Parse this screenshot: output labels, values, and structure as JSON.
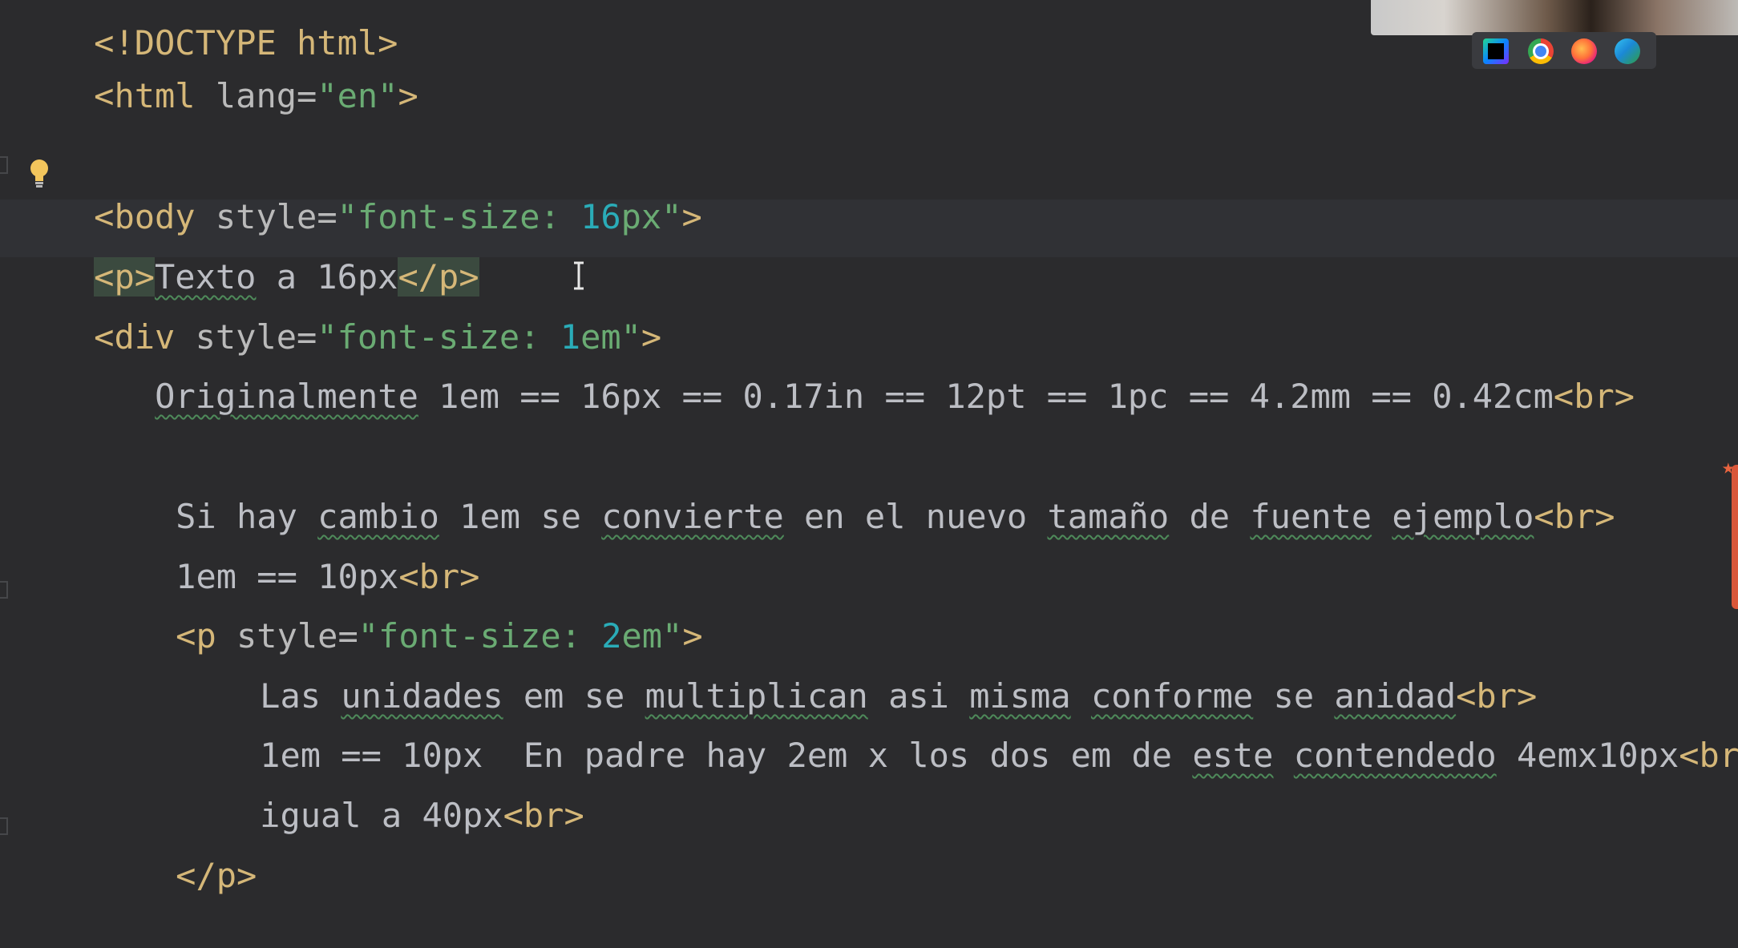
{
  "editor": {
    "lines": {
      "l0": {
        "partial": "<!DOCTYPE html>"
      },
      "l1": {
        "open": "<html",
        "attr": " lang=",
        "val": "\"en\"",
        "close": ">"
      },
      "l3": {
        "open": "<",
        "tag_rest": "body",
        "attr": " style=",
        "q1": "\"font-size: ",
        "num": "16",
        "q2": "px\"",
        "close": ">"
      },
      "l4": {
        "open": "<p>",
        "text1": "Texto",
        "text2": " a 16px",
        "close": "</p>"
      },
      "l5": {
        "open": "<div",
        "attr": " style=",
        "q1": "\"font-size: ",
        "num": "1",
        "q2": "em\"",
        "close": ">"
      },
      "l6": {
        "w1": "Originalmente",
        "rest": " 1em == 16px == 0.17in == 12pt == 1pc == 4.2mm == 0.42cm",
        "br": "<br>"
      },
      "l8": {
        "t1": "Si hay ",
        "w1": "cambio",
        "t2": " 1em se ",
        "w2": "convierte",
        "t3": " en el nuevo ",
        "w3": "tamaño",
        "t4": " de ",
        "w4": "fuente",
        "t5": " ",
        "w5": "ejemplo",
        "br": "<br>"
      },
      "l9": {
        "text": "1em == 10px",
        "br": "<br>"
      },
      "l10": {
        "open": "<p",
        "attr": " style=",
        "q1": "\"font-size: ",
        "num": "2",
        "q2": "em\"",
        "close": ">"
      },
      "l11": {
        "t1": "Las ",
        "w1": "unidades",
        "t2": " em se ",
        "w2": "multiplican",
        "t3": " asi ",
        "w3": "misma",
        "t4": " ",
        "w4": "conforme",
        "t5": " se ",
        "w5": "anidad",
        "br": "<br>"
      },
      "l12": {
        "t1": "1em == 10px  En padre hay 2em x los dos em de ",
        "w1": "este",
        "t2": " ",
        "w2": "contendedo",
        "t3": " 4emx10px",
        "br": "<br>"
      },
      "l13": {
        "text": "igual a 40px",
        "br": "<br>"
      },
      "l14": {
        "close": "</p>"
      }
    }
  },
  "icons": {
    "bulb": "lightbulb-icon",
    "cursor": "text-cursor-icon",
    "browsers": [
      "webstorm-icon",
      "chrome-icon",
      "firefox-icon",
      "edge-icon"
    ]
  },
  "colors": {
    "background": "#2b2b2d",
    "tag": "#d5b778",
    "string": "#6aab73",
    "number": "#2aacb8",
    "text": "#bcbec4"
  }
}
